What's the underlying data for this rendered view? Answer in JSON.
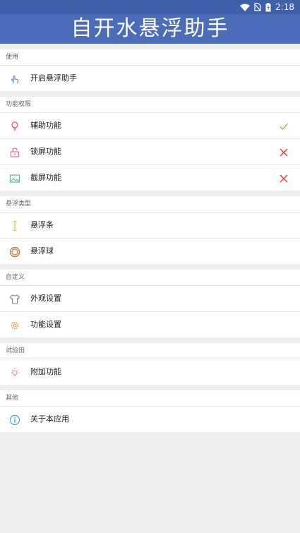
{
  "status_bar": {
    "time": "2:18"
  },
  "app_bar": {
    "title": "自开水悬浮助手"
  },
  "colors": {
    "status_bar": "#3f5fa8",
    "app_bar": "#4a6cb9",
    "check": "#8bc34a",
    "cross": "#e53935"
  },
  "sections": {
    "usage": {
      "header": "使用",
      "items": [
        {
          "label": "开启悬浮助手",
          "icon": "hand-pointer-icon"
        }
      ]
    },
    "permissions": {
      "header": "功能权限",
      "items": [
        {
          "label": "辅助功能",
          "icon": "lightbulb-icon",
          "status": "check-icon"
        },
        {
          "label": "锁屏功能",
          "icon": "lock-icon",
          "status": "cross-icon"
        },
        {
          "label": "截屏功能",
          "icon": "image-icon",
          "status": "cross-icon"
        }
      ]
    },
    "float_type": {
      "header": "悬浮类型",
      "items": [
        {
          "label": "悬浮条",
          "icon": "vertical-bar-icon"
        },
        {
          "label": "悬浮球",
          "icon": "ring-icon"
        }
      ]
    },
    "custom": {
      "header": "自定义",
      "items": [
        {
          "label": "外观设置",
          "icon": "tshirt-icon"
        },
        {
          "label": "功能设置",
          "icon": "gear-icon"
        }
      ]
    },
    "lab": {
      "header": "试验田",
      "items": [
        {
          "label": "附加功能",
          "icon": "bulb-shine-icon"
        }
      ]
    },
    "other": {
      "header": "其他",
      "items": [
        {
          "label": "关于本应用",
          "icon": "info-icon"
        }
      ]
    }
  }
}
